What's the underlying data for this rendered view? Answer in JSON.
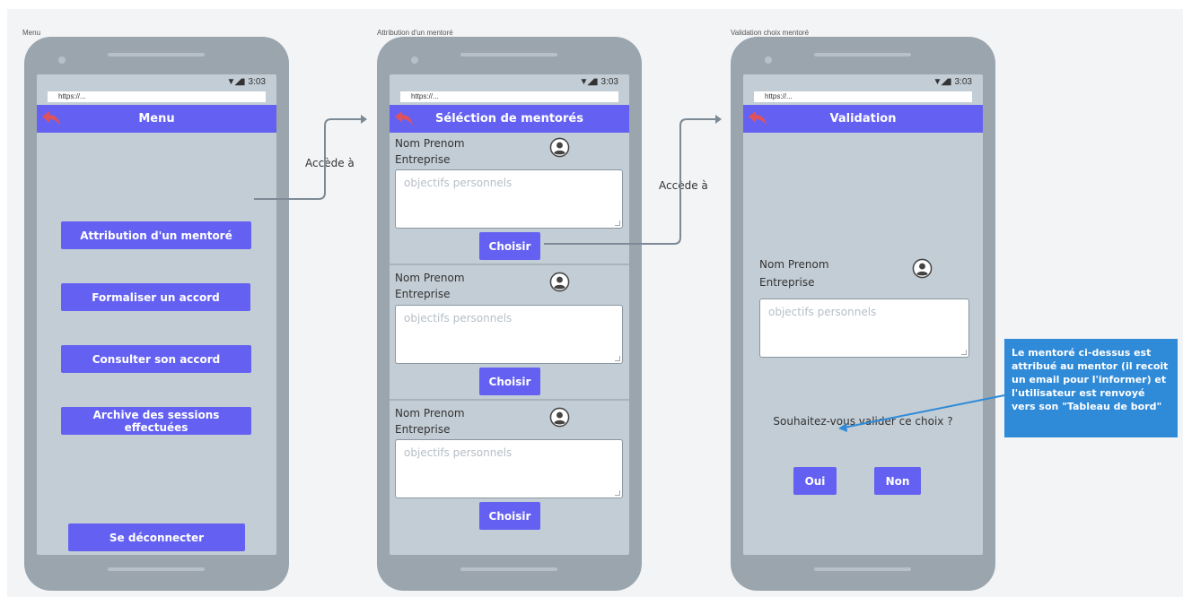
{
  "frames": [
    {
      "label": "Menu",
      "url": "https://...",
      "time": "3:03",
      "title": "Menu",
      "buttons": [
        "Attribution d'un mentoré",
        "Formaliser un accord",
        "Consulter son accord",
        "Archive des sessions effectuées",
        "Se déconnecter"
      ]
    },
    {
      "label": "Attribution d'un mentoré",
      "url": "https://...",
      "time": "3:03",
      "title": "Séléction de mentorés",
      "cards": [
        {
          "name": "Nom Prenom",
          "company": "Entreprise",
          "placeholder": "objectifs personnels",
          "button": "Choisir"
        },
        {
          "name": "Nom Prenom",
          "company": "Entreprise",
          "placeholder": "objectifs personnels",
          "button": "Choisir"
        },
        {
          "name": "Nom Prenom",
          "company": "Entreprise",
          "placeholder": "objectifs personnels",
          "button": "Choisir"
        }
      ]
    },
    {
      "label": "Validation choix mentoré",
      "url": "https://...",
      "time": "3:03",
      "title": "Validation",
      "name": "Nom Prenom",
      "company": "Entreprise",
      "placeholder": "objectifs personnels",
      "question": "Souhaitez-vous valider ce choix ?",
      "yes": "Oui",
      "no": "Non"
    }
  ],
  "connectors": [
    "Accède à",
    "Accède à"
  ],
  "note": "Le mentoré ci-dessus est attribué au mentor (il recoit un email pour l'informer) et l'utilisateur est renvoyé vers son \"Tableau de bord\"",
  "colors": {
    "accent": "#6461f2",
    "back_icon": "#e0525a",
    "note": "#2f8ad8",
    "screen": "#c3cdd5",
    "phone": "#9aa5ae"
  }
}
